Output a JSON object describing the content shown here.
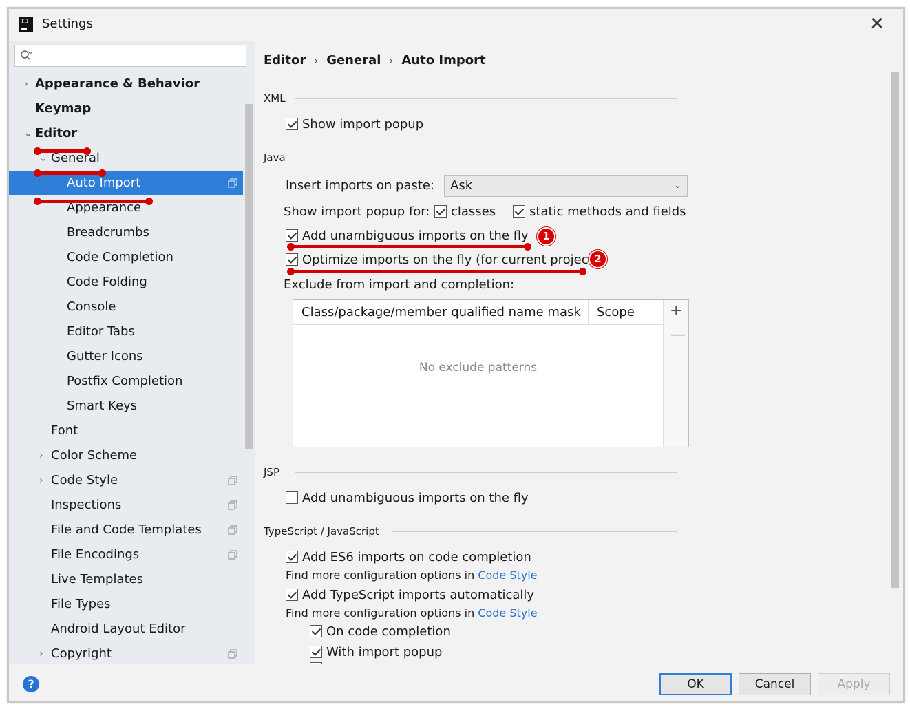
{
  "window": {
    "title": "Settings",
    "close_glyph": "✕"
  },
  "search": {
    "placeholder": ""
  },
  "sidebar": {
    "items": [
      {
        "label": "Appearance & Behavior",
        "arrow": "›",
        "bold": true
      },
      {
        "label": "Keymap",
        "arrow": "",
        "bold": true
      },
      {
        "label": "Editor",
        "arrow": "⌄",
        "bold": true
      },
      {
        "label": "General",
        "arrow": "⌄",
        "bold": false
      },
      {
        "label": "Auto Import",
        "arrow": "",
        "selected": true,
        "copy_icon": true
      },
      {
        "label": "Appearance",
        "arrow": ""
      },
      {
        "label": "Breadcrumbs",
        "arrow": ""
      },
      {
        "label": "Code Completion",
        "arrow": ""
      },
      {
        "label": "Code Folding",
        "arrow": ""
      },
      {
        "label": "Console",
        "arrow": ""
      },
      {
        "label": "Editor Tabs",
        "arrow": ""
      },
      {
        "label": "Gutter Icons",
        "arrow": ""
      },
      {
        "label": "Postfix Completion",
        "arrow": ""
      },
      {
        "label": "Smart Keys",
        "arrow": ""
      },
      {
        "label": "Font",
        "arrow": ""
      },
      {
        "label": "Color Scheme",
        "arrow": "›"
      },
      {
        "label": "Code Style",
        "arrow": "›",
        "copy_icon": true
      },
      {
        "label": "Inspections",
        "arrow": "",
        "copy_icon": true
      },
      {
        "label": "File and Code Templates",
        "arrow": "",
        "copy_icon": true
      },
      {
        "label": "File Encodings",
        "arrow": "",
        "copy_icon": true
      },
      {
        "label": "Live Templates",
        "arrow": ""
      },
      {
        "label": "File Types",
        "arrow": ""
      },
      {
        "label": "Android Layout Editor",
        "arrow": ""
      },
      {
        "label": "Copyright",
        "arrow": "›",
        "copy_icon": true
      }
    ]
  },
  "breadcrumb": {
    "items": [
      "Editor",
      "General",
      "Auto Import"
    ],
    "separator": "›"
  },
  "xml": {
    "title": "XML",
    "show_import_popup": {
      "label": "Show import popup",
      "checked": true
    }
  },
  "java": {
    "title": "Java",
    "insert_imports_label": "Insert imports on paste:",
    "insert_imports_value": "Ask",
    "show_popup_for_label": "Show import popup for:",
    "classes": {
      "label": "classes",
      "checked": true
    },
    "static_methods": {
      "label": "static methods and fields",
      "checked": true
    },
    "add_unambiguous": {
      "label": "Add unambiguous imports on the fly",
      "checked": true
    },
    "optimize_imports": {
      "label": "Optimize imports on the fly (for current project)",
      "checked": true
    },
    "exclude_label": "Exclude from import and completion:",
    "table": {
      "col_name": "Class/package/member qualified name mask",
      "col_scope": "Scope",
      "empty_text": "No exclude patterns",
      "add_glyph": "+",
      "remove_glyph": "—"
    }
  },
  "jsp": {
    "title": "JSP",
    "add_unambiguous": {
      "label": "Add unambiguous imports on the fly",
      "checked": false
    }
  },
  "typescript": {
    "title": "TypeScript / JavaScript",
    "add_es6": {
      "label": "Add ES6 imports on code completion",
      "checked": true
    },
    "find_more_prefix": "Find more configuration options in",
    "code_style_link": "Code Style",
    "add_ts": {
      "label": "Add TypeScript imports automatically",
      "checked": true
    },
    "on_code_completion": {
      "label": "On code completion",
      "checked": true
    },
    "with_import_popup": {
      "label": "With import popup",
      "checked": true
    }
  },
  "annotations": {
    "badge1": "1",
    "badge2": "2",
    "color": "#d40000"
  },
  "footer": {
    "help_glyph": "?",
    "ok": "OK",
    "cancel": "Cancel",
    "apply": "Apply"
  }
}
